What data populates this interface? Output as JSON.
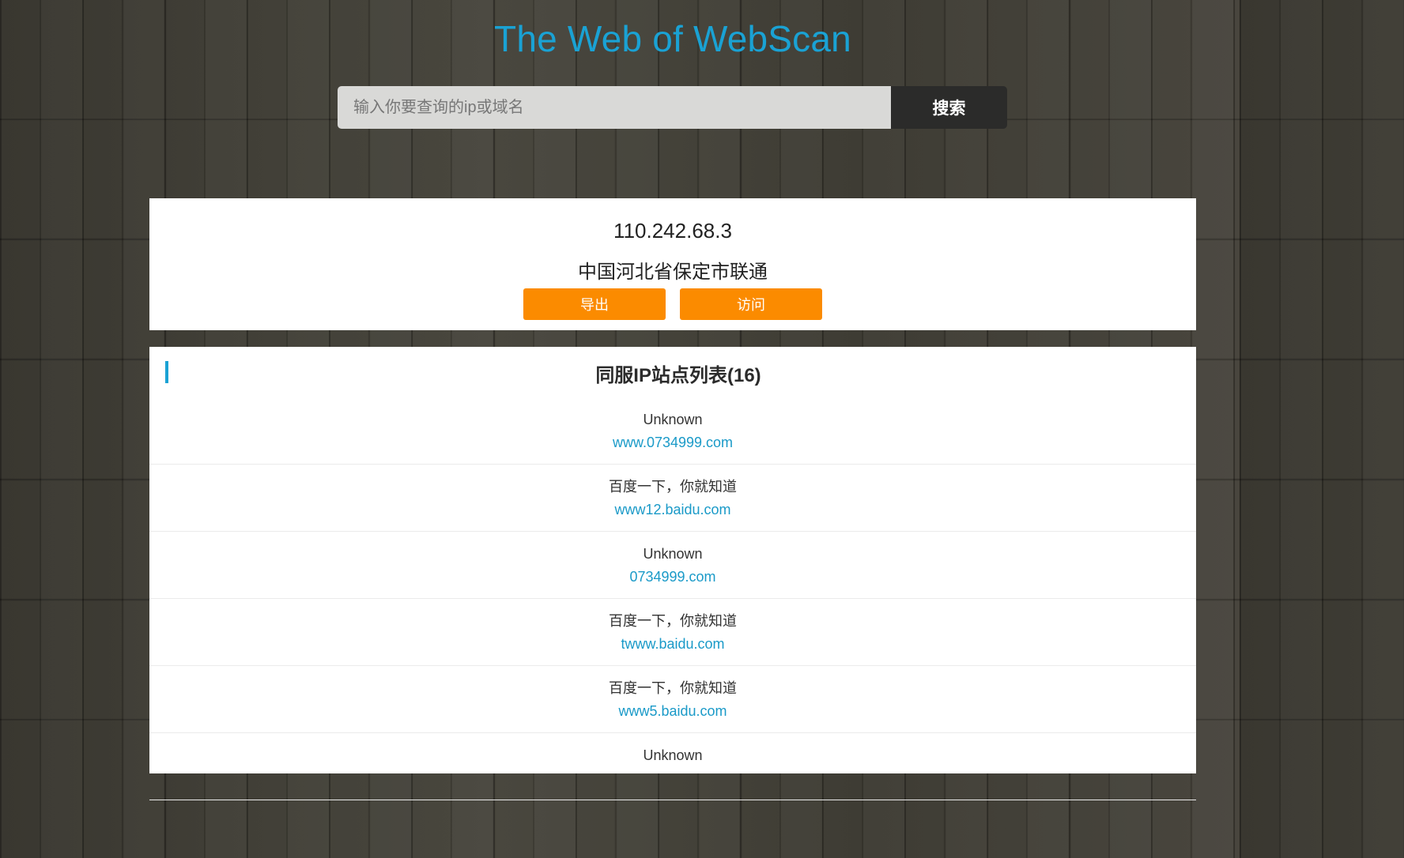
{
  "header": {
    "title": "The Web of WebScan"
  },
  "search": {
    "placeholder": "输入你要查询的ip或域名",
    "button_label": "搜索"
  },
  "info": {
    "ip": "110.242.68.3",
    "location": "中国河北省保定市联通",
    "export_label": "导出",
    "visit_label": "访问"
  },
  "site_list": {
    "title": "同服IP站点列表(16)",
    "items": [
      {
        "name": "Unknown",
        "domain": "www.0734999.com"
      },
      {
        "name": "百度一下，你就知道",
        "domain": "www12.baidu.com"
      },
      {
        "name": "Unknown",
        "domain": "0734999.com"
      },
      {
        "name": "百度一下，你就知道",
        "domain": "twww.baidu.com"
      },
      {
        "name": "百度一下，你就知道",
        "domain": "www5.baidu.com"
      },
      {
        "name": "Unknown",
        "domain": ""
      }
    ]
  },
  "colors": {
    "accent": "#1aa2d4",
    "button_orange": "#fb8b00",
    "search_button": "#2b2b2a"
  }
}
